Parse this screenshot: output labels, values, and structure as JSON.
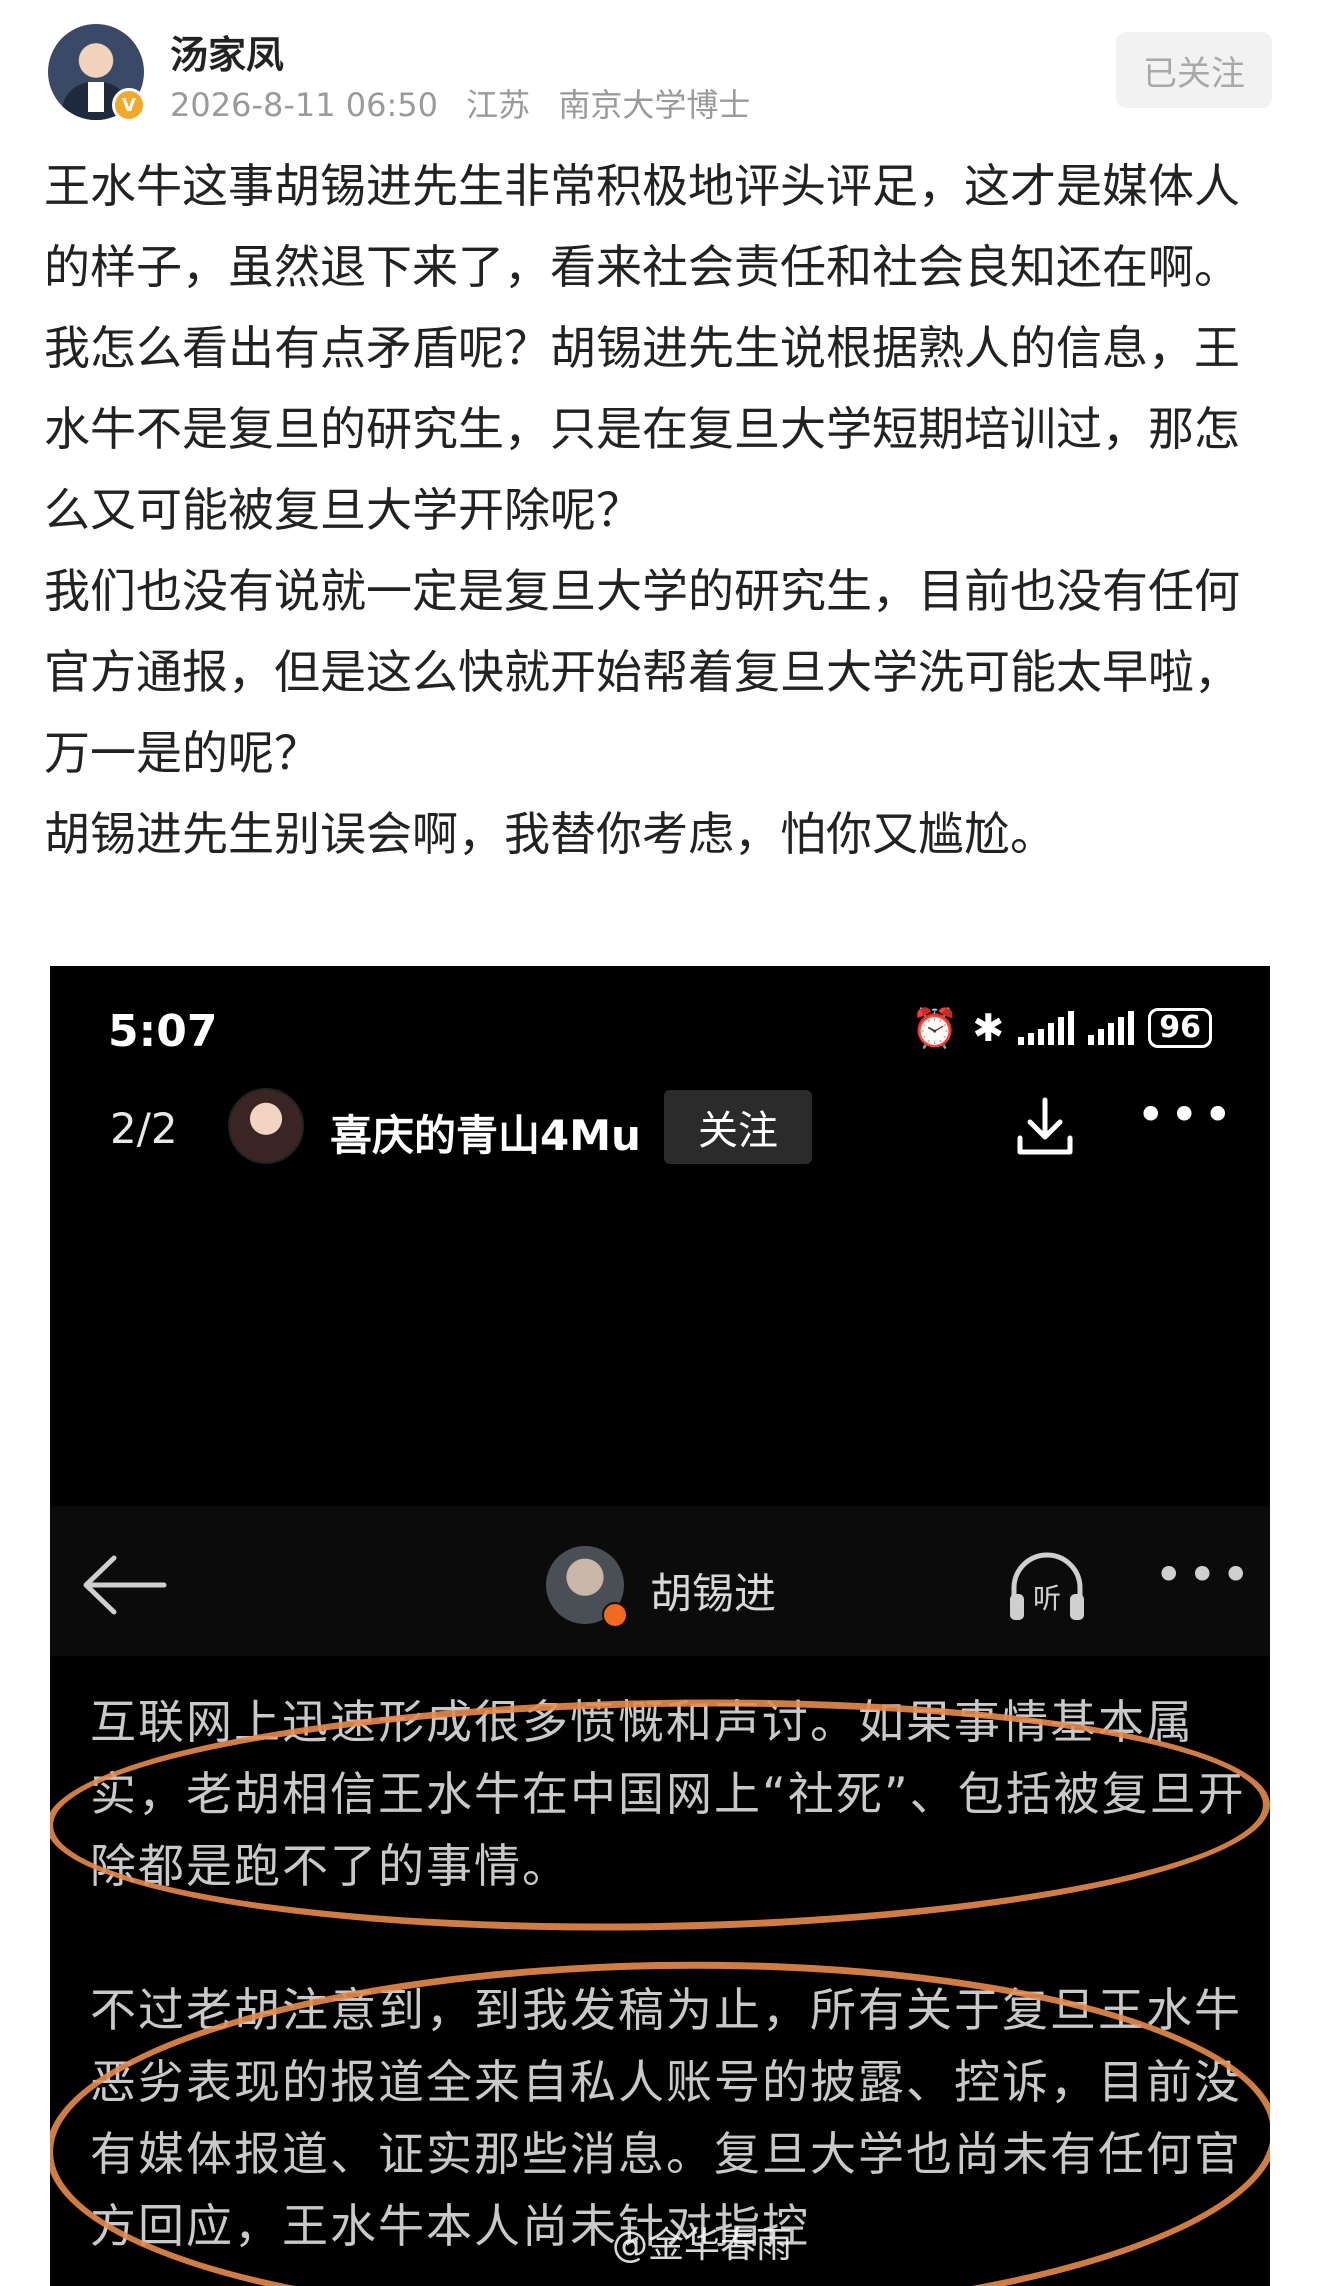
{
  "post": {
    "author": "汤家凤",
    "date": "2026-8-11 06:50",
    "location": "江苏",
    "title_tag": "南京大学博士",
    "follow_label": "已关注",
    "paragraphs": [
      "王水牛这事胡锡进先生非常积极地评头评足，这才是媒体人的样子，虽然退下来了，看来社会责任和社会良知还在啊。",
      "我怎么看出有点矛盾呢？胡锡进先生说根据熟人的信息，王水牛不是复旦的研究生，只是在复旦大学短期培训过，那怎么又可能被复旦大学开除呢？",
      "我们也没有说就一定是复旦大学的研究生，目前也没有任何官方通报，但是这么快就开始帮着复旦大学洗可能太早啦，万一是的呢？",
      "胡锡进先生别误会啊，我替你考虑，怕你又尴尬。"
    ]
  },
  "screenshot": {
    "status_time": "5:07",
    "battery": "96",
    "page_count": "2/2",
    "username": "喜庆的青山4Mu",
    "follow_label": "关注",
    "article_author": "胡锡进",
    "listen_label": "听",
    "article_paragraphs": [
      "互联网上迅速形成很多愤慨和声讨。如果事情基本属实，老胡相信王水牛在中国网上“社死”、包括被复旦开除都是跑不了的事情。",
      "不过老胡注意到，到我发稿为止，所有关于复旦王水牛恶劣表现的报道全来自私人账号的披露、控诉，目前没有媒体报道、证实那些消息。复旦大学也尚未有任何官方回应，王水牛本人尚未针对指控"
    ]
  },
  "watermark": "@金华春雨",
  "colors": {
    "highlight_ellipse": "#e58a4d",
    "verify_badge": "#f1a92c"
  }
}
